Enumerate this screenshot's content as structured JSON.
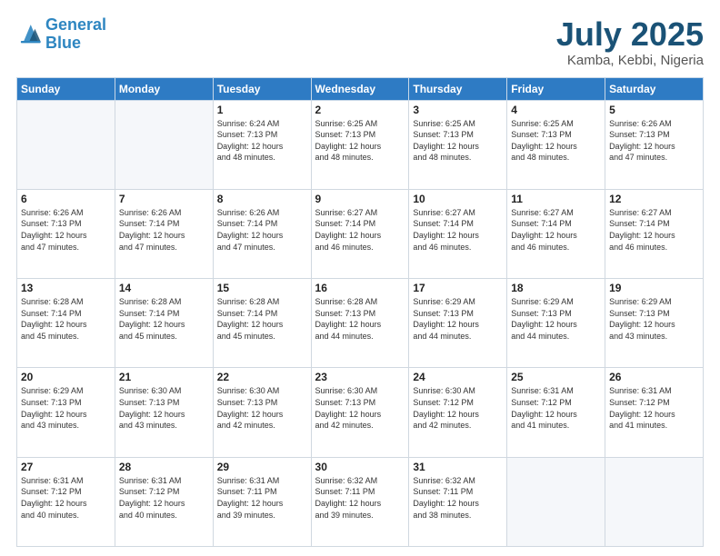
{
  "header": {
    "logo_line1": "General",
    "logo_line2": "Blue",
    "month_year": "July 2025",
    "location": "Kamba, Kebbi, Nigeria"
  },
  "weekdays": [
    "Sunday",
    "Monday",
    "Tuesday",
    "Wednesday",
    "Thursday",
    "Friday",
    "Saturday"
  ],
  "weeks": [
    [
      {
        "day": "",
        "info": ""
      },
      {
        "day": "",
        "info": ""
      },
      {
        "day": "1",
        "info": "Sunrise: 6:24 AM\nSunset: 7:13 PM\nDaylight: 12 hours\nand 48 minutes."
      },
      {
        "day": "2",
        "info": "Sunrise: 6:25 AM\nSunset: 7:13 PM\nDaylight: 12 hours\nand 48 minutes."
      },
      {
        "day": "3",
        "info": "Sunrise: 6:25 AM\nSunset: 7:13 PM\nDaylight: 12 hours\nand 48 minutes."
      },
      {
        "day": "4",
        "info": "Sunrise: 6:25 AM\nSunset: 7:13 PM\nDaylight: 12 hours\nand 48 minutes."
      },
      {
        "day": "5",
        "info": "Sunrise: 6:26 AM\nSunset: 7:13 PM\nDaylight: 12 hours\nand 47 minutes."
      }
    ],
    [
      {
        "day": "6",
        "info": "Sunrise: 6:26 AM\nSunset: 7:13 PM\nDaylight: 12 hours\nand 47 minutes."
      },
      {
        "day": "7",
        "info": "Sunrise: 6:26 AM\nSunset: 7:14 PM\nDaylight: 12 hours\nand 47 minutes."
      },
      {
        "day": "8",
        "info": "Sunrise: 6:26 AM\nSunset: 7:14 PM\nDaylight: 12 hours\nand 47 minutes."
      },
      {
        "day": "9",
        "info": "Sunrise: 6:27 AM\nSunset: 7:14 PM\nDaylight: 12 hours\nand 46 minutes."
      },
      {
        "day": "10",
        "info": "Sunrise: 6:27 AM\nSunset: 7:14 PM\nDaylight: 12 hours\nand 46 minutes."
      },
      {
        "day": "11",
        "info": "Sunrise: 6:27 AM\nSunset: 7:14 PM\nDaylight: 12 hours\nand 46 minutes."
      },
      {
        "day": "12",
        "info": "Sunrise: 6:27 AM\nSunset: 7:14 PM\nDaylight: 12 hours\nand 46 minutes."
      }
    ],
    [
      {
        "day": "13",
        "info": "Sunrise: 6:28 AM\nSunset: 7:14 PM\nDaylight: 12 hours\nand 45 minutes."
      },
      {
        "day": "14",
        "info": "Sunrise: 6:28 AM\nSunset: 7:14 PM\nDaylight: 12 hours\nand 45 minutes."
      },
      {
        "day": "15",
        "info": "Sunrise: 6:28 AM\nSunset: 7:14 PM\nDaylight: 12 hours\nand 45 minutes."
      },
      {
        "day": "16",
        "info": "Sunrise: 6:28 AM\nSunset: 7:13 PM\nDaylight: 12 hours\nand 44 minutes."
      },
      {
        "day": "17",
        "info": "Sunrise: 6:29 AM\nSunset: 7:13 PM\nDaylight: 12 hours\nand 44 minutes."
      },
      {
        "day": "18",
        "info": "Sunrise: 6:29 AM\nSunset: 7:13 PM\nDaylight: 12 hours\nand 44 minutes."
      },
      {
        "day": "19",
        "info": "Sunrise: 6:29 AM\nSunset: 7:13 PM\nDaylight: 12 hours\nand 43 minutes."
      }
    ],
    [
      {
        "day": "20",
        "info": "Sunrise: 6:29 AM\nSunset: 7:13 PM\nDaylight: 12 hours\nand 43 minutes."
      },
      {
        "day": "21",
        "info": "Sunrise: 6:30 AM\nSunset: 7:13 PM\nDaylight: 12 hours\nand 43 minutes."
      },
      {
        "day": "22",
        "info": "Sunrise: 6:30 AM\nSunset: 7:13 PM\nDaylight: 12 hours\nand 42 minutes."
      },
      {
        "day": "23",
        "info": "Sunrise: 6:30 AM\nSunset: 7:13 PM\nDaylight: 12 hours\nand 42 minutes."
      },
      {
        "day": "24",
        "info": "Sunrise: 6:30 AM\nSunset: 7:12 PM\nDaylight: 12 hours\nand 42 minutes."
      },
      {
        "day": "25",
        "info": "Sunrise: 6:31 AM\nSunset: 7:12 PM\nDaylight: 12 hours\nand 41 minutes."
      },
      {
        "day": "26",
        "info": "Sunrise: 6:31 AM\nSunset: 7:12 PM\nDaylight: 12 hours\nand 41 minutes."
      }
    ],
    [
      {
        "day": "27",
        "info": "Sunrise: 6:31 AM\nSunset: 7:12 PM\nDaylight: 12 hours\nand 40 minutes."
      },
      {
        "day": "28",
        "info": "Sunrise: 6:31 AM\nSunset: 7:12 PM\nDaylight: 12 hours\nand 40 minutes."
      },
      {
        "day": "29",
        "info": "Sunrise: 6:31 AM\nSunset: 7:11 PM\nDaylight: 12 hours\nand 39 minutes."
      },
      {
        "day": "30",
        "info": "Sunrise: 6:32 AM\nSunset: 7:11 PM\nDaylight: 12 hours\nand 39 minutes."
      },
      {
        "day": "31",
        "info": "Sunrise: 6:32 AM\nSunset: 7:11 PM\nDaylight: 12 hours\nand 38 minutes."
      },
      {
        "day": "",
        "info": ""
      },
      {
        "day": "",
        "info": ""
      }
    ]
  ]
}
